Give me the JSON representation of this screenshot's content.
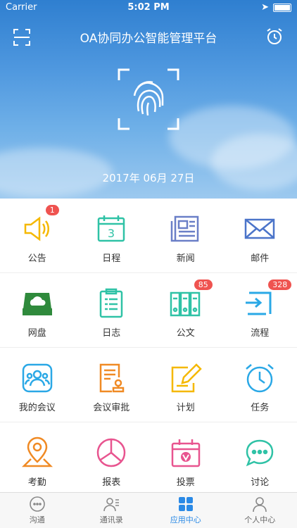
{
  "status": {
    "carrier": "Carrier",
    "time": "5:02 PM"
  },
  "header": {
    "title": "OA协同办公智能管理平台",
    "date": "2017年 06月 27日"
  },
  "apps": [
    {
      "label": "公告",
      "icon": "speaker-icon",
      "badge": "1",
      "color": "#f5b800"
    },
    {
      "label": "日程",
      "icon": "calendar-icon",
      "badge": "",
      "color": "#2fc2a6"
    },
    {
      "label": "新闻",
      "icon": "newspaper-icon",
      "badge": "",
      "color": "#6a7fc7"
    },
    {
      "label": "邮件",
      "icon": "mail-icon",
      "badge": "",
      "color": "#4b74c9"
    },
    {
      "label": "网盘",
      "icon": "cloud-drive-icon",
      "badge": "",
      "color": "#2f8a3c"
    },
    {
      "label": "日志",
      "icon": "clipboard-icon",
      "badge": "",
      "color": "#2fc2a6"
    },
    {
      "label": "公文",
      "icon": "binders-icon",
      "badge": "85",
      "color": "#2fc2a6"
    },
    {
      "label": "流程",
      "icon": "process-icon",
      "badge": "328",
      "color": "#2aa8e6"
    },
    {
      "label": "我的会议",
      "icon": "meeting-icon",
      "badge": "",
      "color": "#2aa8e6"
    },
    {
      "label": "会议审批",
      "icon": "approval-icon",
      "badge": "",
      "color": "#f08a24"
    },
    {
      "label": "计划",
      "icon": "plan-icon",
      "badge": "",
      "color": "#f5b800"
    },
    {
      "label": "任务",
      "icon": "alarm-clock-icon",
      "badge": "",
      "color": "#2aa8e6"
    },
    {
      "label": "考勤",
      "icon": "location-icon",
      "badge": "",
      "color": "#f08a24"
    },
    {
      "label": "报表",
      "icon": "pie-chart-icon",
      "badge": "",
      "color": "#e8548f"
    },
    {
      "label": "投票",
      "icon": "vote-icon",
      "badge": "",
      "color": "#e8548f"
    },
    {
      "label": "讨论",
      "icon": "chat-icon",
      "badge": "",
      "color": "#2fc2a6"
    }
  ],
  "tabs": [
    {
      "label": "沟通",
      "icon": "chat-bubble-icon"
    },
    {
      "label": "通讯录",
      "icon": "contacts-icon"
    },
    {
      "label": "应用中心",
      "icon": "apps-grid-icon"
    },
    {
      "label": "个人中心",
      "icon": "person-icon"
    }
  ],
  "accent": "#2b8ae6"
}
